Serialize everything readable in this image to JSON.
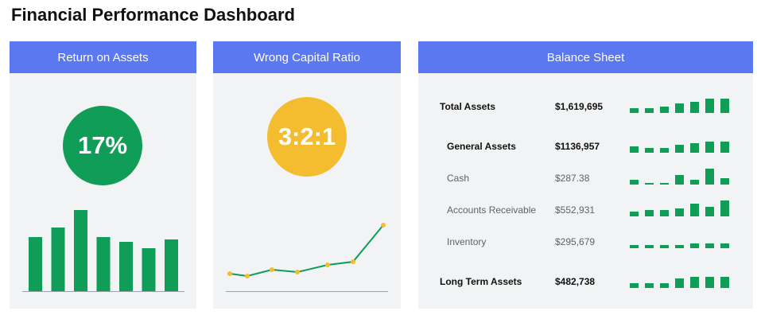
{
  "page": {
    "title": "Financial Performance Dashboard"
  },
  "colors": {
    "header": "#5b78f0",
    "green": "#0f9d58",
    "yellow": "#f4bc2f",
    "card_bg": "#f1f3f4"
  },
  "roa": {
    "header": "Return on Assets",
    "kpi": "17%",
    "chart_data": {
      "type": "bar",
      "values": [
        68,
        80,
        102,
        68,
        62,
        54,
        65
      ],
      "ylim": [
        0,
        110
      ]
    }
  },
  "wcr": {
    "header": "Wrong Capital Ratio",
    "kpi": "3:2:1",
    "chart_data": {
      "type": "line",
      "values": [
        22,
        19,
        27,
        24,
        33,
        37,
        83
      ],
      "ylim": [
        0,
        100
      ]
    }
  },
  "balance": {
    "header": "Balance Sheet",
    "rows": [
      {
        "label": "Total Assets",
        "value": "$1,619,695",
        "style": "strong",
        "spark": [
          3,
          3,
          4,
          6,
          7,
          9,
          9
        ]
      },
      {
        "label": "General Assets",
        "value": "$1136,957",
        "style": "sub-strong",
        "spark": [
          4,
          3,
          3,
          5,
          6,
          7,
          7
        ]
      },
      {
        "label": "Cash",
        "value": "$287.38",
        "style": "muted",
        "spark": [
          3,
          1,
          1,
          6,
          3,
          10,
          4
        ]
      },
      {
        "label": "Accounts Receivable",
        "value": "$552,931",
        "style": "muted",
        "spark": [
          3,
          4,
          4,
          5,
          8,
          6,
          10
        ]
      },
      {
        "label": "Inventory",
        "value": "$295,679",
        "style": "muted",
        "spark": [
          2,
          2,
          2,
          2,
          3,
          3,
          3
        ]
      },
      {
        "label": "Long Term Assets",
        "value": "$482,738",
        "style": "strong",
        "spark": [
          3,
          3,
          3,
          6,
          7,
          7,
          7
        ]
      }
    ]
  }
}
